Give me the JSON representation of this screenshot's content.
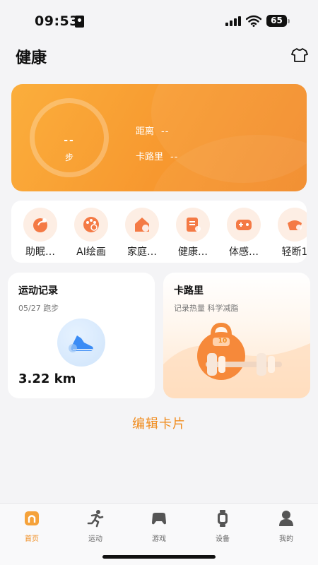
{
  "status_bar": {
    "time": "09:53",
    "battery": "65"
  },
  "header": {
    "title": "健康",
    "outfit_icon": "tshirt-icon"
  },
  "hero": {
    "steps_value": "--",
    "steps_unit": "步",
    "distance_label": "距离",
    "distance_value": "--",
    "calories_label": "卡路里",
    "calories_value": "--"
  },
  "apps": [
    {
      "label": "助眠…",
      "icon": "sleep-icon"
    },
    {
      "label": "AI绘画",
      "icon": "palette-icon"
    },
    {
      "label": "家庭…",
      "icon": "family-icon"
    },
    {
      "label": "健康…",
      "icon": "health-doc-icon"
    },
    {
      "label": "体感…",
      "icon": "gamepad-icon"
    },
    {
      "label": "轻断1",
      "icon": "fasting-icon"
    }
  ],
  "cards": {
    "exercise": {
      "title": "运动记录",
      "subtitle": "05/27 跑步",
      "distance": "3.22 km",
      "icon": "running-shoe-icon"
    },
    "calories": {
      "title": "卡路里",
      "subtitle": "记录热量 科学减脂",
      "kettlebell_weight": "10",
      "icon": "kettlebell-icon"
    }
  },
  "edit_cards_label": "编辑卡片",
  "tabs": [
    {
      "label": "首页",
      "icon": "home-icon",
      "active": true
    },
    {
      "label": "运动",
      "icon": "running-icon",
      "active": false
    },
    {
      "label": "游戏",
      "icon": "gamepad-icon",
      "active": false
    },
    {
      "label": "设备",
      "icon": "watch-icon",
      "active": false
    },
    {
      "label": "我的",
      "icon": "user-icon",
      "active": false
    }
  ],
  "colors": {
    "accent": "#f08c1e",
    "hero_start": "#fbae3c",
    "hero_end": "#f28b2a",
    "background": "#f4f4f6"
  }
}
